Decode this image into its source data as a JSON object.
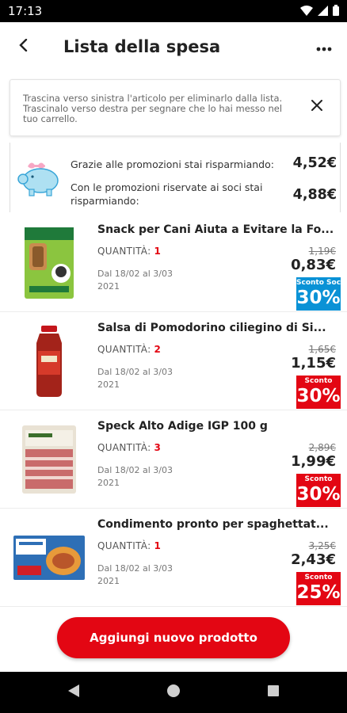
{
  "status_bar": {
    "time": "17:13"
  },
  "app_bar": {
    "title": "Lista della spesa"
  },
  "info": {
    "text": "Trascina verso sinistra l'articolo per eliminarlo dalla lista. Trascinalo verso destra per segnare che lo hai messo nel tuo carrello."
  },
  "savings": {
    "promo_label": "Grazie alle promozioni stai risparmiando:",
    "promo_value": "4,52€",
    "member_label": "Con le promozioni riservate ai soci stai risparmiando:",
    "member_value": "4,88€"
  },
  "products": [
    {
      "name": "Snack per Cani Aiuta a Evitare la Fo...",
      "qty_label": "QUANTITÀ:",
      "qty": "1",
      "validity": "Dal 18/02 al 3/03 2021",
      "old_price": "1,19€",
      "new_price": "0,83€",
      "badge_label": "Sconto Soci",
      "badge_value": "30%",
      "badge_color": "#0a92d6"
    },
    {
      "name": "Salsa di Pomodorino ciliegino di Si...",
      "qty_label": "QUANTITÀ:",
      "qty": "2",
      "validity": "Dal 18/02 al 3/03 2021",
      "old_price": "1,65€",
      "new_price": "1,15€",
      "badge_label": "Sconto",
      "badge_value": "30%",
      "badge_color": "#e30613"
    },
    {
      "name": "Speck Alto Adige IGP 100 g",
      "qty_label": "QUANTITÀ:",
      "qty": "3",
      "validity": "Dal 18/02 al 3/03 2021",
      "old_price": "2,89€",
      "new_price": "1,99€",
      "badge_label": "Sconto",
      "badge_value": "30%",
      "badge_color": "#e30613"
    },
    {
      "name": "Condimento pronto per spaghettat...",
      "qty_label": "QUANTITÀ:",
      "qty": "1",
      "validity": "Dal 18/02 al 3/03 2021",
      "old_price": "3,25€",
      "new_price": "2,43€",
      "badge_label": "Sconto",
      "badge_value": "25%",
      "badge_color": "#e30613"
    }
  ],
  "cta": {
    "label": "Aggiungi nuovo prodotto"
  },
  "colors": {
    "accent": "#e30613",
    "member_blue": "#0a92d6"
  },
  "icons": [
    "back-arrow-icon",
    "more-vert-icon",
    "close-icon",
    "piggy-bank-icon",
    "wifi-icon",
    "signal-icon",
    "battery-icon",
    "nav-back-icon",
    "nav-home-icon",
    "nav-recents-icon"
  ]
}
